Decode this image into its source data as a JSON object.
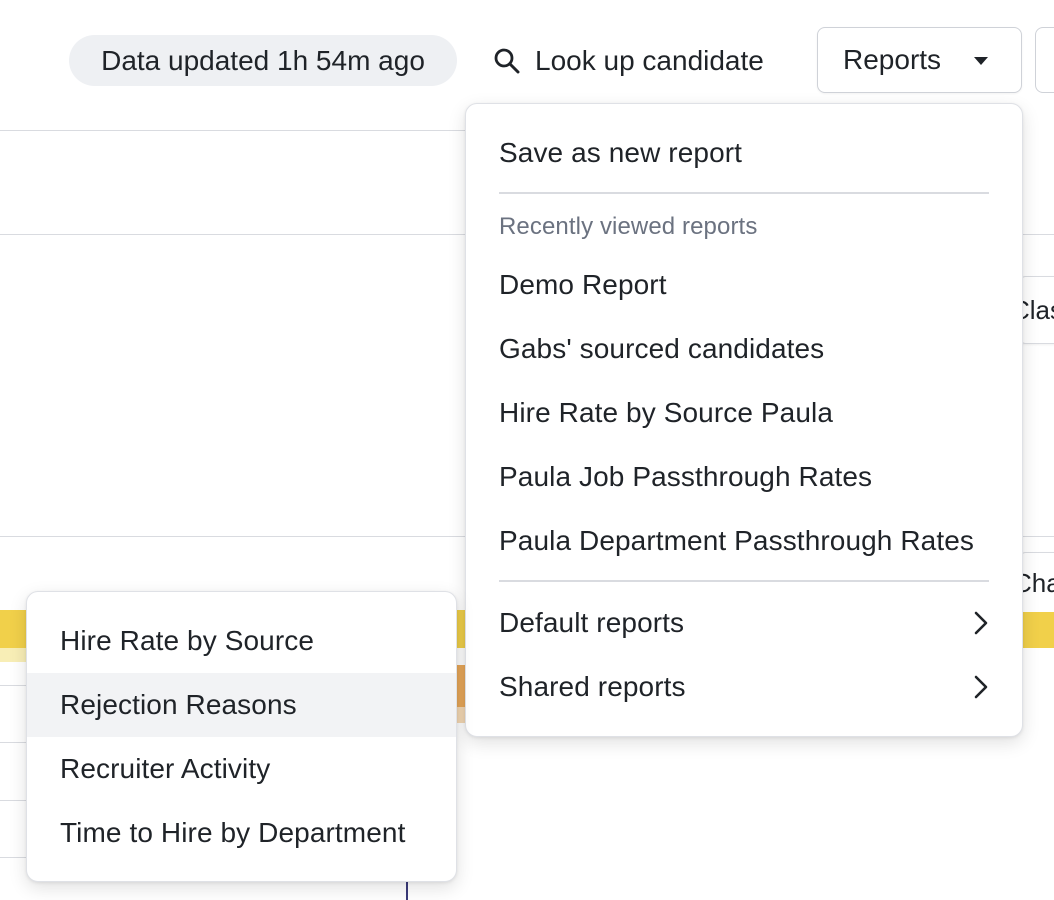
{
  "header": {
    "data_updated": "Data updated 1h 54m ago",
    "lookup_label": "Look up candidate",
    "reports_label": "Reports"
  },
  "background": {
    "fragment_1": "Clas",
    "fragment_2": "Chan"
  },
  "reports_menu": {
    "save_label": "Save as new report",
    "recent_heading": "Recently viewed reports",
    "recent_items": [
      "Demo Report",
      "Gabs' sourced candidates",
      "Hire Rate by Source Paula",
      "Paula Job Passthrough Rates",
      "Paula Department Passthrough Rates"
    ],
    "default_label": "Default reports",
    "shared_label": "Shared reports"
  },
  "default_reports_submenu": {
    "items": [
      "Hire Rate by Source",
      "Rejection Reasons",
      "Recruiter Activity",
      "Time to Hire by Department"
    ],
    "hovered": "Rejection Reasons"
  },
  "icons": {
    "search": "search-icon",
    "caret": "caret-down-icon",
    "chevron": "chevron-right-icon"
  }
}
